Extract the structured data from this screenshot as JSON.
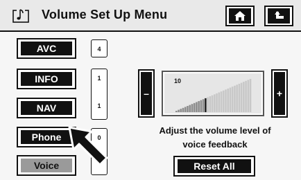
{
  "header": {
    "title": "Volume Set Up Menu",
    "icons": {
      "music": "music-note-icon",
      "home": "home-icon",
      "back": "back-arrow-icon"
    }
  },
  "menu": {
    "items": [
      {
        "label": "AVC",
        "level": "4"
      },
      {
        "label": "INFO",
        "level": "1"
      },
      {
        "label": "NAV",
        "level": "1"
      },
      {
        "label": "Phone",
        "level": "0"
      },
      {
        "label": "Voice",
        "level": "",
        "selected": true
      }
    ]
  },
  "volume": {
    "level": "10",
    "level_fraction": 0.39,
    "minus_label": "–",
    "plus_label": "+",
    "description_line1": "Adjust the volume level of",
    "description_line2": "voice feedback"
  },
  "reset_label": "Reset All",
  "colors": {
    "button": "#111111",
    "selected": "#9a9a9a",
    "background": "#f6f6f6"
  }
}
